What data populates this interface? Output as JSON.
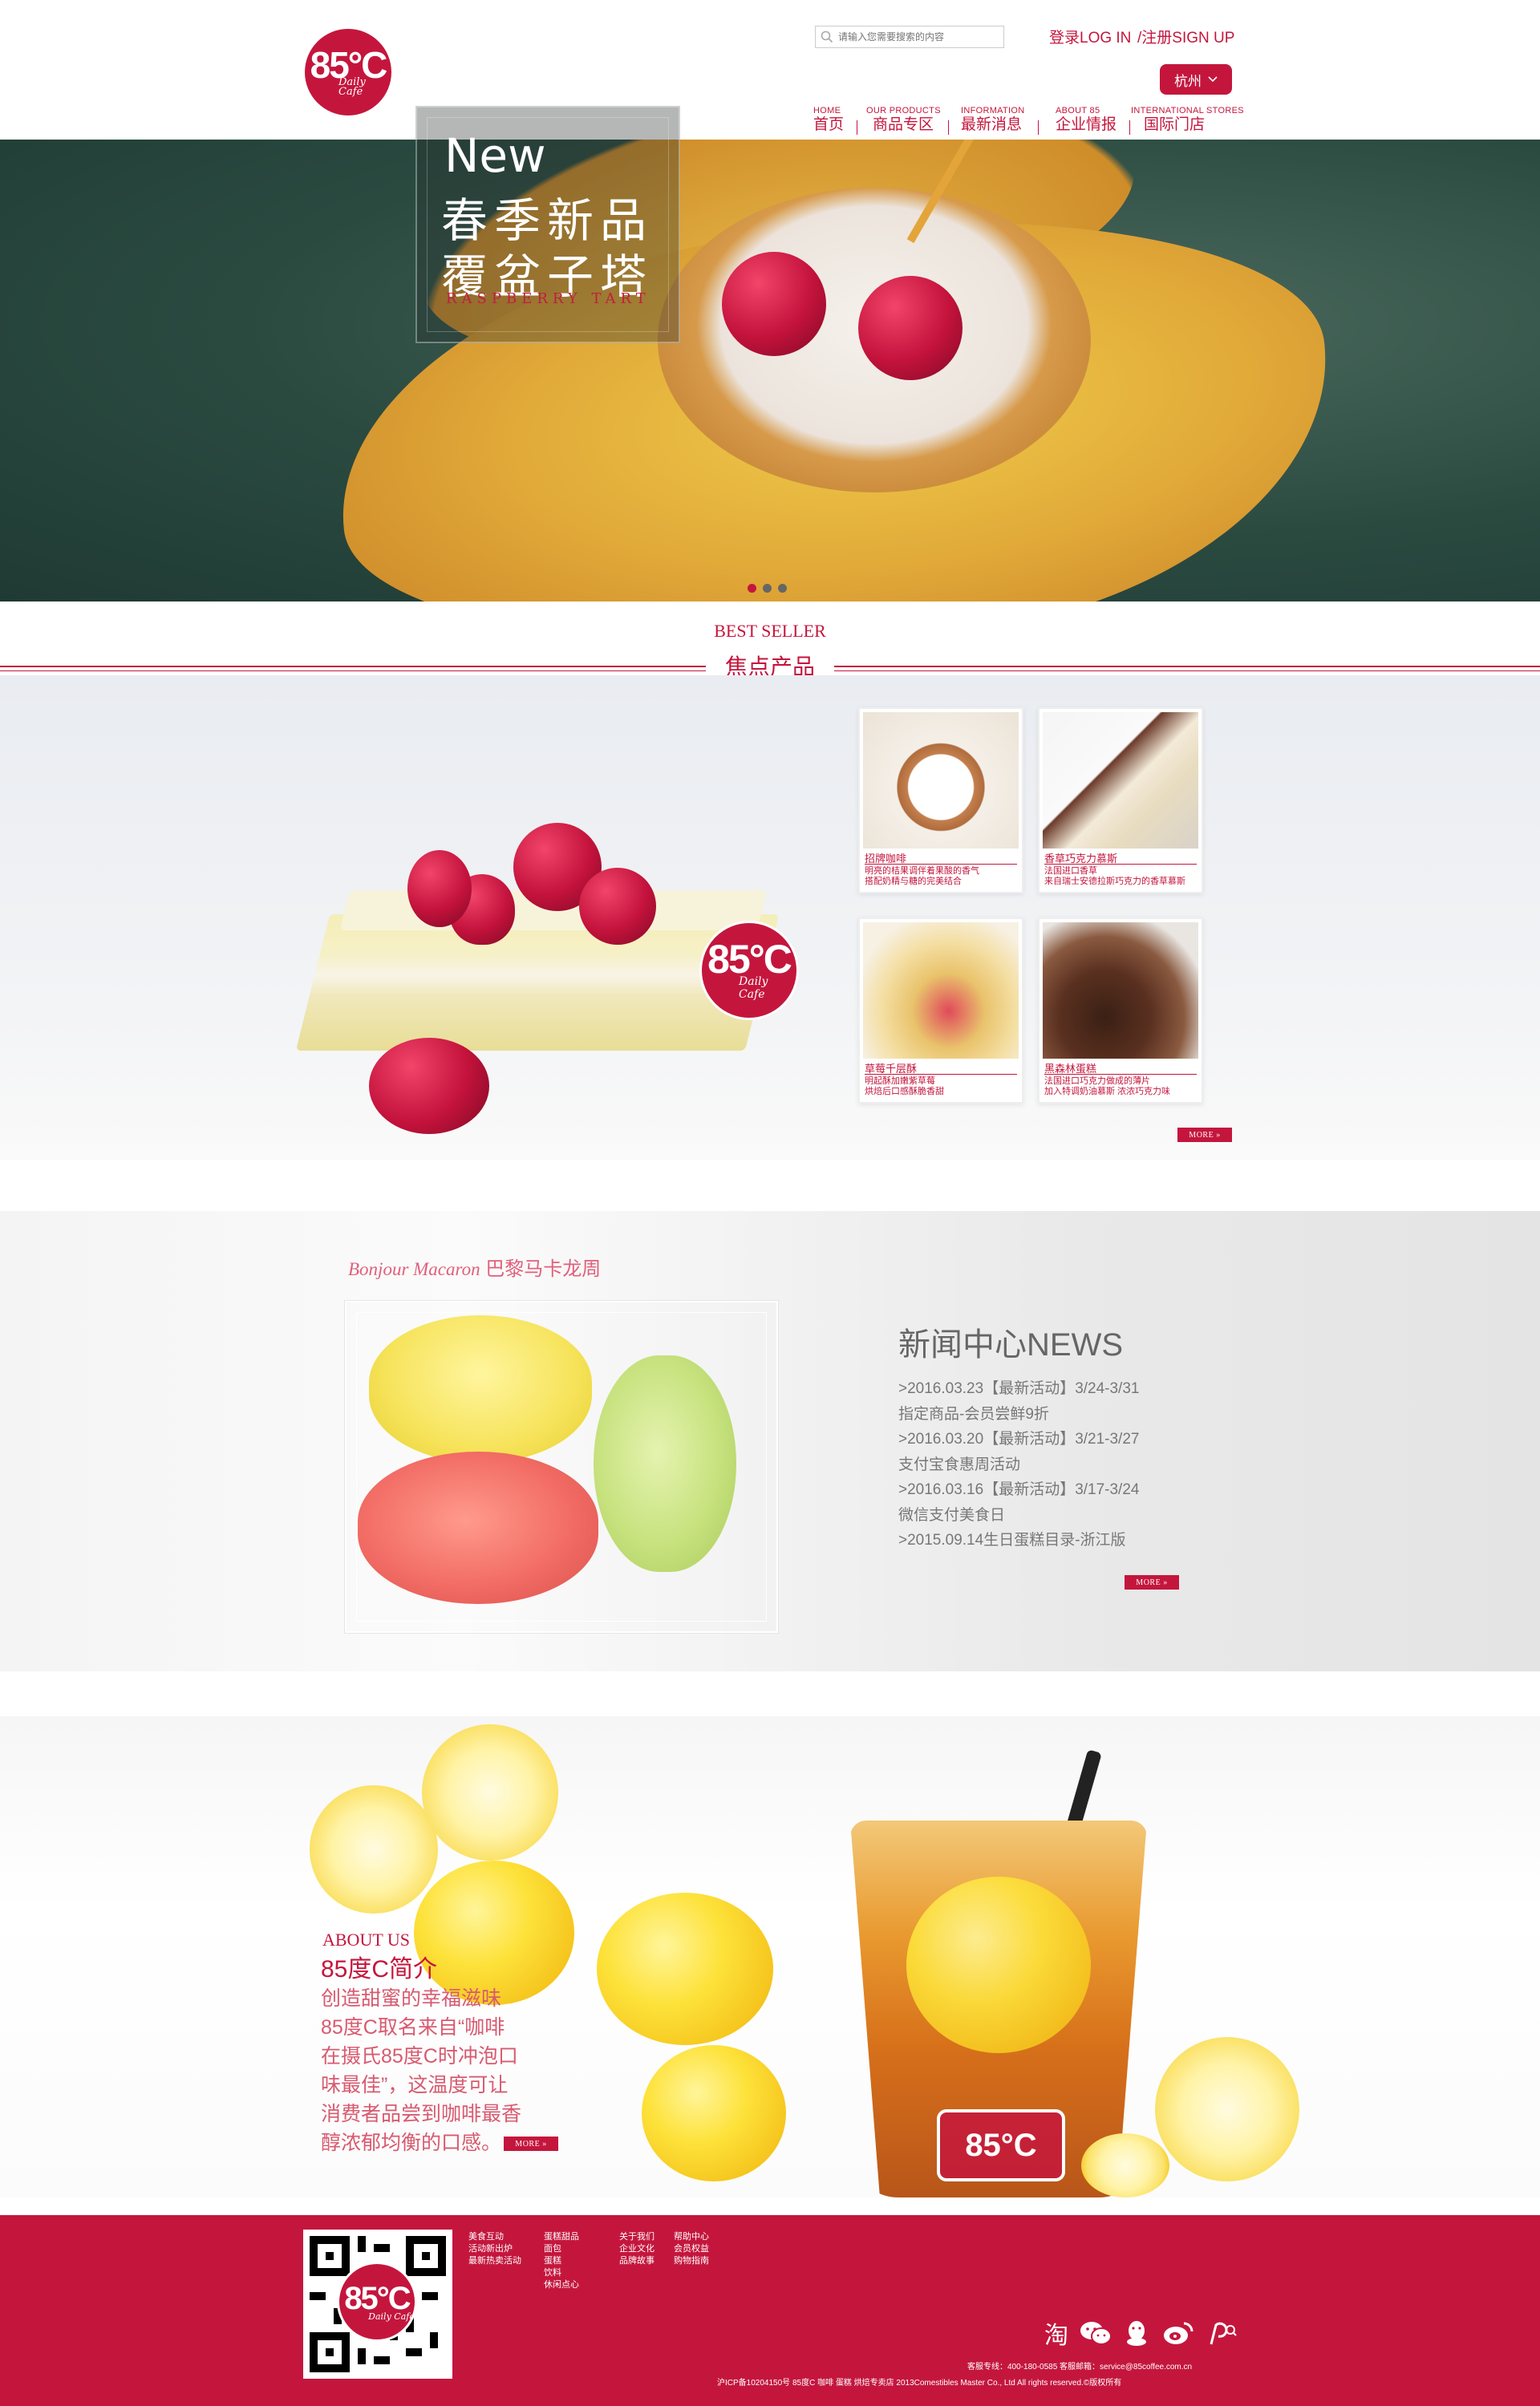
{
  "header": {
    "logo_text": "85°C",
    "logo_sub": "Daily Cafe",
    "search_placeholder": "请输入您需要搜索的内容",
    "login": "登录LOG IN",
    "register": "/注册SIGN UP",
    "city": "杭州",
    "nav": [
      {
        "en": "HOME",
        "cn": "首页"
      },
      {
        "en": "OUR PRODUCTS",
        "cn": "商品专区"
      },
      {
        "en": "INFORMATION",
        "cn": "最新消息"
      },
      {
        "en": "ABOUT 85",
        "cn": "企业情报"
      },
      {
        "en": "INTERNATIONAL STORES",
        "cn": "国际门店"
      }
    ]
  },
  "hero": {
    "new": "New",
    "line1": "春季新品",
    "line2": "覆盆子塔",
    "english": "RASPBERRY TART",
    "active_slide": 1,
    "slide_count": 3
  },
  "best_seller": {
    "title_en": "BEST SELLER",
    "title_cn": "焦点产品",
    "logo_text": "85°C",
    "logo_sub": "Daily Cafe",
    "products": [
      {
        "name": "招牌咖啡",
        "desc1": "明亮的桔果调伴着果酸的香气",
        "desc2": "搭配奶精与糖的完美结合"
      },
      {
        "name": "香草巧克力慕斯",
        "desc1": "法国进口香草",
        "desc2": "来自瑞士安德拉斯巧克力的香草慕斯"
      },
      {
        "name": "草莓千层酥",
        "desc1": "明起酥加嫩紫草莓",
        "desc2": "烘焙后口感酥脆香甜"
      },
      {
        "name": "黑森林蛋糕",
        "desc1": "法国进口巧克力做成的薄片",
        "desc2": "加入特调奶油慕斯 浓浓巧克力味"
      }
    ],
    "more": "MORE"
  },
  "news": {
    "macaron_en": "Bonjour Macaron",
    "macaron_cn": "巴黎马卡龙周",
    "title": "新闻中心NEWS",
    "items": [
      ">2016.03.23【最新活动】3/24-3/31",
      "指定商品-会员尝鲜9折",
      ">2016.03.20【最新活动】3/21-3/27",
      "支付宝食惠周活动",
      ">2016.03.16【最新活动】3/17-3/24",
      "微信支付美食日",
      ">2015.09.14生日蛋糕目录-浙江版"
    ],
    "more": "MORE"
  },
  "about": {
    "title_en": "ABOUT US",
    "title_cn": "85度C简介",
    "lines": [
      "创造甜蜜的幸福滋味",
      "85度C取名来自“咖啡",
      "在摄氏85度C时冲泡口",
      "味最佳”，这温度可让",
      "消费者品尝到咖啡最香",
      "醇浓郁均衡的口感。"
    ],
    "more": "MORE",
    "cup_logo": "85°C"
  },
  "footer": {
    "qr_logo": "85°C",
    "qr_sub": "Daily Cafe",
    "col1": [
      "美食互动",
      "活动新出炉",
      "最新热卖活动"
    ],
    "col2": [
      "蛋糕甜品",
      "面包",
      "蛋糕",
      "饮料",
      "休闲点心"
    ],
    "col3": [
      "关于我们",
      "企业文化",
      "品牌故事"
    ],
    "col4": [
      "帮助中心",
      "会员权益",
      "购物指南"
    ],
    "hotline": "客服专线：400-180-0585   客服邮箱：service@85coffee.com.cn",
    "copyright": "沪ICP备10204150号    85度C 咖啡 蛋糕 烘焙专卖店    2013Comestibles Master Co., Ltd All rights reserved.©版权所有",
    "social_icons": [
      "taobao-icon",
      "wechat-icon",
      "qq-icon",
      "weibo-icon",
      "pinterest-icon"
    ]
  },
  "colors": {
    "brand": "#c4163d",
    "text": "#333333",
    "muted": "#777777"
  }
}
